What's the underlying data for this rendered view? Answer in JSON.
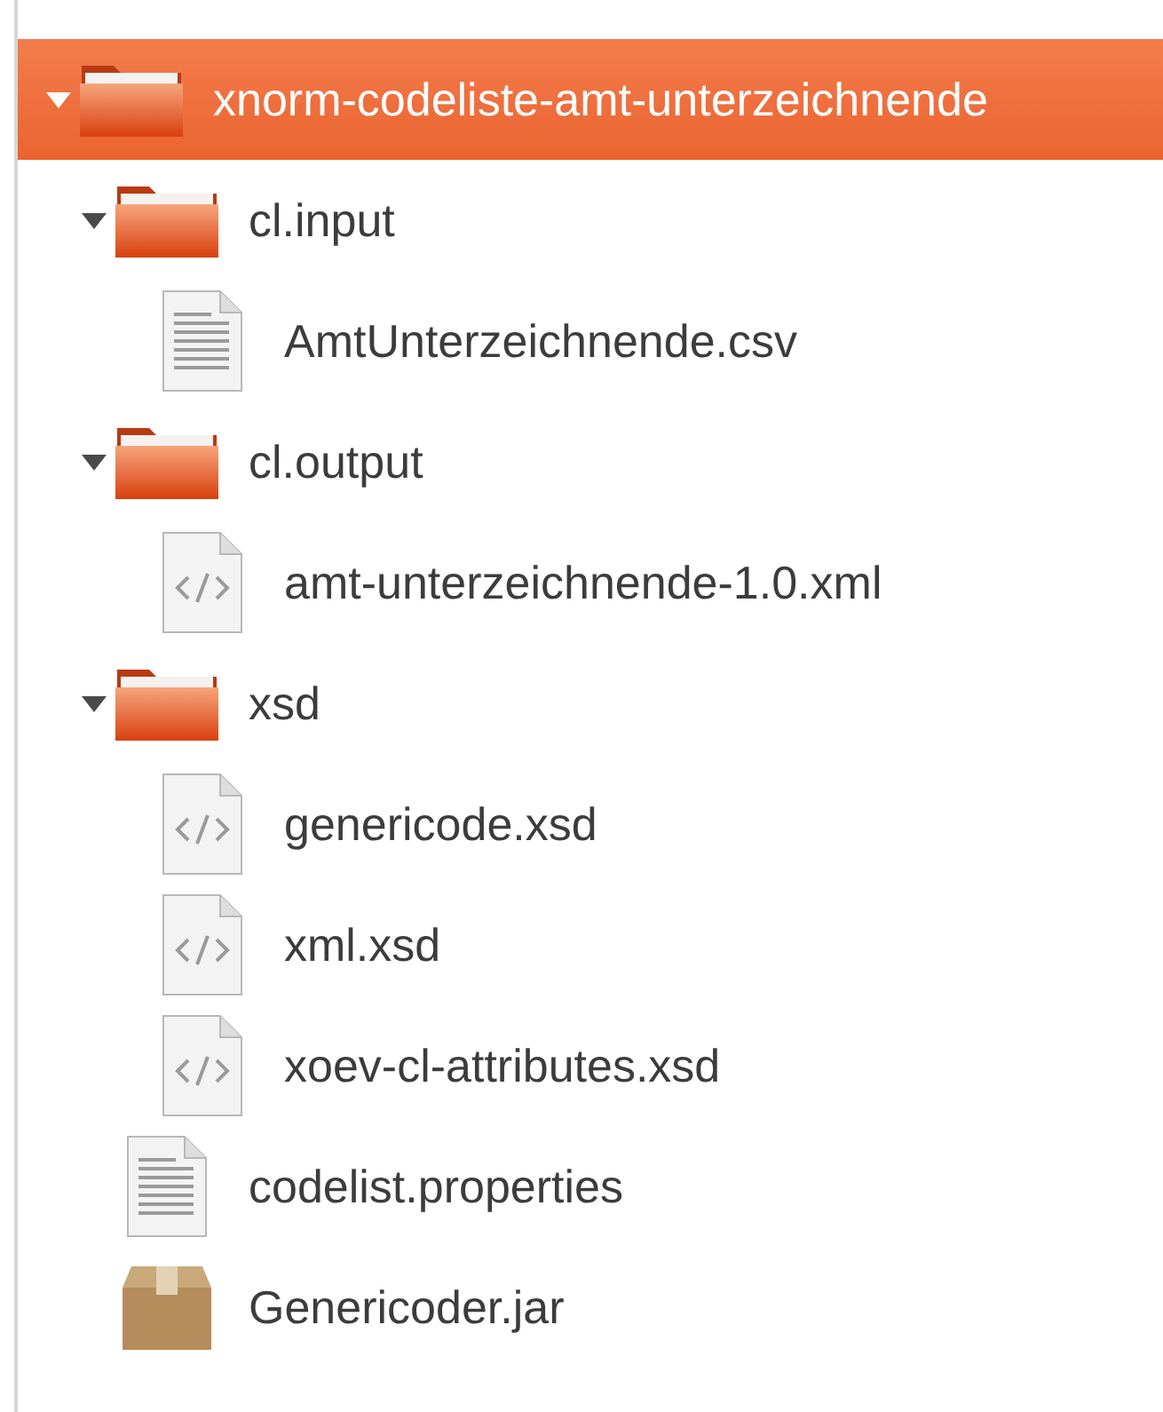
{
  "tree": [
    {
      "label": "xnorm-codeliste-amt-unterzeichnende",
      "kind": "folder",
      "expanded": true,
      "selected": true,
      "children": [
        {
          "label": "cl.input",
          "kind": "folder",
          "expanded": true,
          "selected": false,
          "children": [
            {
              "label": "AmtUnterzeichnende.csv",
              "kind": "text-file",
              "selected": false
            }
          ]
        },
        {
          "label": "cl.output",
          "kind": "folder",
          "expanded": true,
          "selected": false,
          "children": [
            {
              "label": "amt-unterzeichnende-1.0.xml",
              "kind": "code-file",
              "selected": false
            }
          ]
        },
        {
          "label": "xsd",
          "kind": "folder",
          "expanded": true,
          "selected": false,
          "children": [
            {
              "label": "genericode.xsd",
              "kind": "code-file",
              "selected": false
            },
            {
              "label": "xml.xsd",
              "kind": "code-file",
              "selected": false
            },
            {
              "label": "xoev-cl-attributes.xsd",
              "kind": "code-file",
              "selected": false
            }
          ]
        },
        {
          "label": "codelist.properties",
          "kind": "text-file",
          "selected": false
        },
        {
          "label": "Genericoder.jar",
          "kind": "package",
          "selected": false
        }
      ]
    }
  ]
}
